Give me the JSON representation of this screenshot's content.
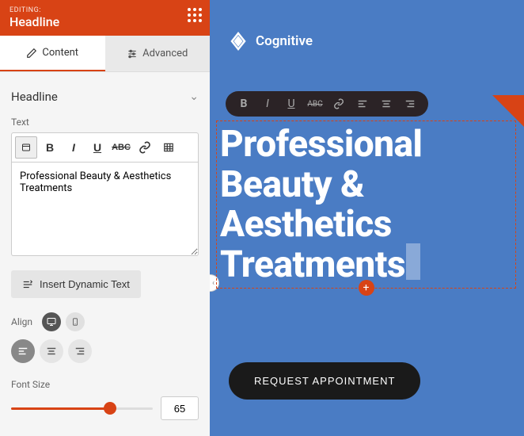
{
  "header": {
    "editing_label": "EDITING:",
    "title": "Headline"
  },
  "tabs": {
    "content": "Content",
    "advanced": "Advanced"
  },
  "section": {
    "title": "Headline"
  },
  "text": {
    "label": "Text",
    "value": "Professional Beauty & Aesthetics Treatments"
  },
  "insert_dynamic": "Insert Dynamic Text",
  "align": {
    "label": "Align"
  },
  "font_size": {
    "label": "Font Size",
    "value": "65",
    "percent": 70
  },
  "canvas": {
    "brand": "Cognitive",
    "headline": "Professional Beauty & Aesthetics Treatments",
    "cta": "REQUEST APPOINTMENT"
  },
  "colors": {
    "accent": "#d84315",
    "canvas_bg": "#4a7cc4"
  }
}
